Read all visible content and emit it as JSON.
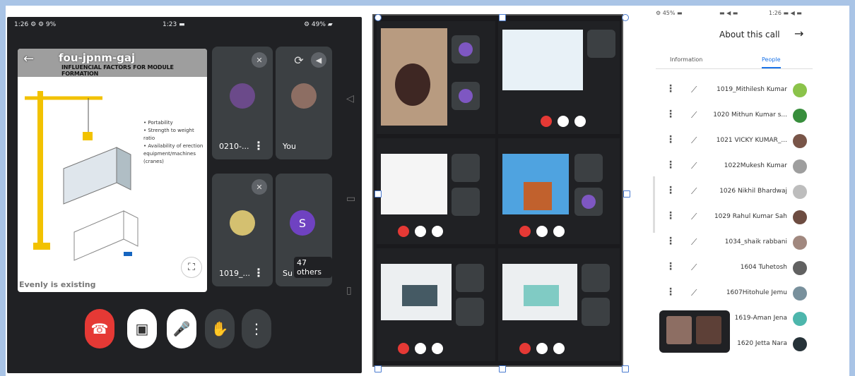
{
  "phone": {
    "status_left": "1:26 ⚙ ⚙ 9%",
    "status_mid": "1:23 ▬",
    "status_right": "⚙ 49% ▰",
    "meeting_code": "fou-jpnm-gaj",
    "slide_title": "INFLUENCIAL FACTORS FOR MODULE FORMATION",
    "slide_bullets": [
      "• Portability",
      "• Strength to weight ratio",
      "• Availability of erection",
      "  equipment/machines",
      "  (cranes)"
    ],
    "slide_caption": "Evenly is existing",
    "tiles": [
      {
        "name": "0210-...",
        "icon": "mic-off-icon"
      },
      {
        "name": "You",
        "icon": "mic-icon"
      },
      {
        "name": "1019_...",
        "icon": "mic-off-icon"
      },
      {
        "name": "Su",
        "icon": "mic-icon",
        "others": "47 others",
        "initial": "S"
      }
    ],
    "controls": [
      "end-call",
      "camera-off",
      "mic-off",
      "raise-hand",
      "more"
    ]
  },
  "grid": {
    "cells": 6
  },
  "panel": {
    "status_left": "⚙ 45% ▬",
    "status_mid": "▬ ◀ ▬",
    "status_right": "1:26 ▬ ◀ ▬",
    "title": "About this call",
    "tab_people": "People",
    "tab_information": "Information",
    "participants": [
      "1019_Mithilesh Kumar",
      "1020 Mithun Kumar s...",
      "1021 VICKY KUMAR_...",
      "1022Mukesh Kumar",
      "1026 Nikhil Bhardwaj",
      "1029 Rahul Kumar Sah",
      "1034_shaik rabbani",
      "1604 Tuhetosh",
      "1607Hitohule Jemu",
      "1619-Aman Jena",
      "1620 Jetta Nara"
    ]
  }
}
